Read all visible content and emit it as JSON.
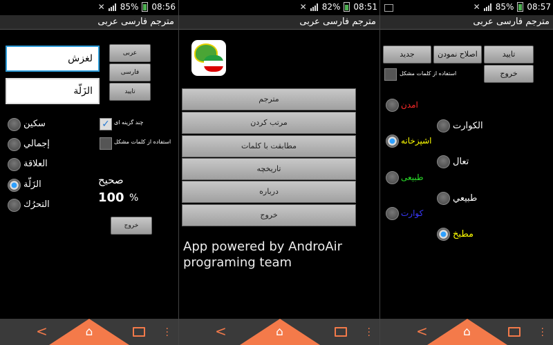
{
  "screen1": {
    "status": {
      "battery_pct": "85%",
      "time": "08:56"
    },
    "title": "مترجم فارسی عربی",
    "input_persian": "لغزش",
    "output_arabic": "الزَلّة",
    "buttons": {
      "arabic": "عربی",
      "persian": "فارسی",
      "confirm": "تایید",
      "exit": "خروج"
    },
    "multi_choice_label": "چند گزینه ای",
    "hard_words_label": "استفاده از کلمات مشکل",
    "options": [
      "سكين",
      "إجمالي",
      "العلاقة",
      "الزَلّة",
      "التحرُك"
    ],
    "selected_option_index": 3,
    "correct_label": "صحیح",
    "score_value": "100",
    "score_unit": "%"
  },
  "screen2": {
    "status": {
      "battery_pct": "82%",
      "time": "08:51"
    },
    "title": "مترجم فارسی عربی",
    "menu": [
      "مترجم",
      "مرتب کردن",
      "مطابقت با کلمات",
      "تاریخچه",
      "درباره",
      "خروج"
    ],
    "credit_line1": "App powered by AndroAir",
    "credit_line2": "programing team"
  },
  "screen3": {
    "status": {
      "battery_pct": "85%",
      "time": "08:57"
    },
    "title": "مترجم فارسی عربی",
    "buttons": {
      "new": "جدید",
      "edit": "اصلاح نمودن",
      "confirm": "تایید",
      "exit": "خروج"
    },
    "hard_words_label": "استفاده از کلمات مشکل",
    "left_words": [
      {
        "text": "امدن",
        "color": "#ff2a2a",
        "selected": false
      },
      {
        "text": "اشپزخانه",
        "color": "#ffff00",
        "selected": true
      },
      {
        "text": "طبیعی",
        "color": "#2adf2a",
        "selected": false
      },
      {
        "text": "کوارت",
        "color": "#3a3aff",
        "selected": false
      }
    ],
    "right_words": [
      {
        "text": "الكوارت",
        "color": "#ffffff",
        "selected": false
      },
      {
        "text": "تعال",
        "color": "#ffffff",
        "selected": false
      },
      {
        "text": "طبيعي",
        "color": "#ffffff",
        "selected": false
      },
      {
        "text": "مطبخ",
        "color": "#ffff00",
        "selected": true
      }
    ]
  }
}
